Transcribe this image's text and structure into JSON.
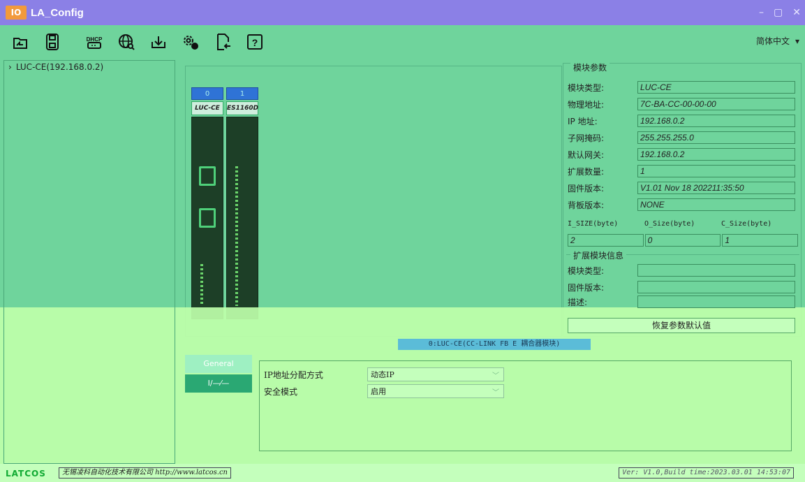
{
  "window": {
    "logo": "IO",
    "title": "LA_Config",
    "controls": [
      "–",
      "▢",
      "✕"
    ]
  },
  "toolbar": {
    "buttons": [
      {
        "name": "open",
        "icon": "open-folder-icon"
      },
      {
        "name": "save",
        "icon": "save-icon"
      },
      {
        "name": "dhcp",
        "icon": "dhcp-icon",
        "label": "DHCP"
      },
      {
        "name": "network-search",
        "icon": "globe-search-icon"
      },
      {
        "name": "download",
        "icon": "download-icon"
      },
      {
        "name": "settings",
        "icon": "gears-icon"
      },
      {
        "name": "export",
        "icon": "file-export-icon"
      },
      {
        "name": "help",
        "icon": "help-icon",
        "label": "?"
      }
    ],
    "language": "简体中文"
  },
  "tree": {
    "items": [
      {
        "label": "LUC-CE(192.168.0.2)"
      }
    ]
  },
  "rack": {
    "slots": [
      {
        "index": "0",
        "name": "LUC-CE"
      },
      {
        "index": "1",
        "name": "ES1160D"
      }
    ]
  },
  "params": {
    "title": "模块参数",
    "fields": [
      {
        "label": "模块类型:",
        "value": "LUC-CE"
      },
      {
        "label": "物理地址:",
        "value": "7C-BA-CC-00-00-00"
      },
      {
        "label": " IP 地址:",
        "value": "192.168.0.2"
      },
      {
        "label": "子网掩码:",
        "value": "255.255.255.0"
      },
      {
        "label": "默认网关:",
        "value": "192.168.0.2"
      },
      {
        "label": "扩展数量:",
        "value": "1"
      },
      {
        "label": "固件版本:",
        "value": "V1.01 Nov 18 202211:35:50"
      },
      {
        "label": "背板版本:",
        "value": "NONE"
      }
    ],
    "size_labels": [
      "I_SIZE(byte)",
      "O_Size(byte)",
      "C_Size(byte)"
    ],
    "size_values": [
      "2",
      "0",
      "1"
    ],
    "ext_title": "扩展模块信息",
    "ext_fields": [
      {
        "label": "模块类型:",
        "value": ""
      },
      {
        "label": "固件版本:",
        "value": ""
      },
      {
        "label": "描述:",
        "value": ""
      }
    ],
    "restore_label": "恢复参数默认值"
  },
  "status": {
    "module_text": "0:LUC-CE(CC-LINK FB E 耦合器模块)"
  },
  "tabs": [
    {
      "label": "General"
    },
    {
      "label": "I/—⁄—"
    }
  ],
  "config": {
    "rows": [
      {
        "label": "IP地址分配方式",
        "value": "动态IP"
      },
      {
        "label": "安全模式",
        "value": "启用"
      }
    ]
  },
  "footer": {
    "brand": "LATCOS",
    "company": "无锡凌科自动化技术有限公司 http://www.latcos.cn",
    "version": "Ver: V1.0,Build time:2023.03.01 14:53:07"
  }
}
